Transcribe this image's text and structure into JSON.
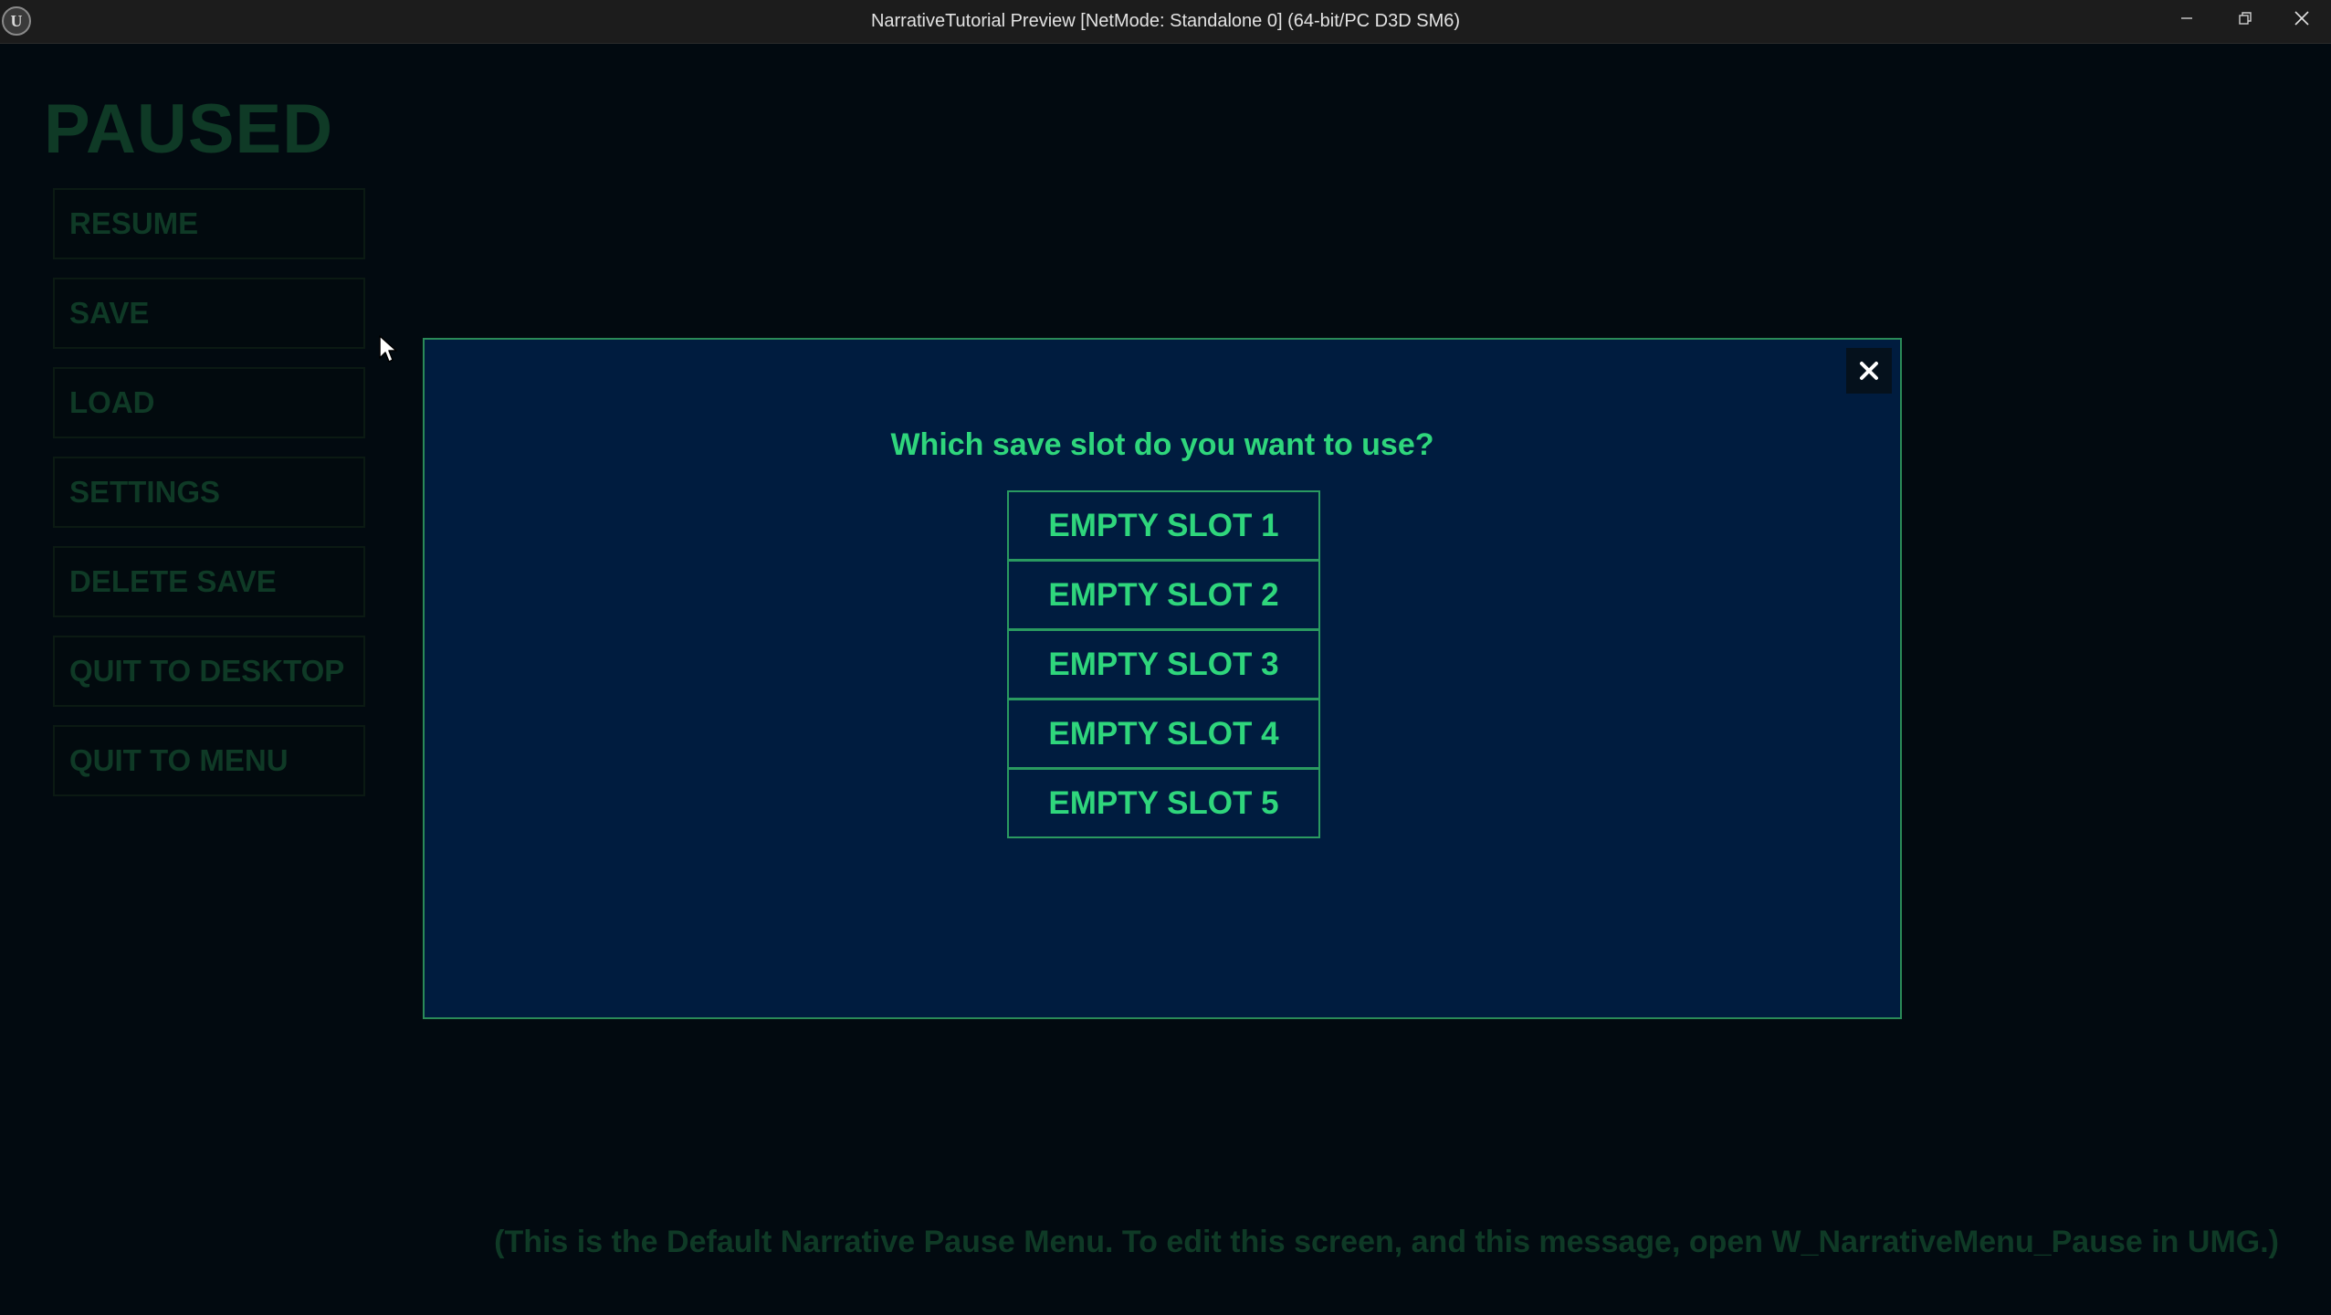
{
  "window": {
    "logo_label": "U",
    "title": "NarrativeTutorial Preview [NetMode: Standalone 0]  (64-bit/PC D3D SM6)",
    "controls": {
      "minimize_icon": "minimize-icon",
      "restore_icon": "restore-icon",
      "close_icon": "close-icon"
    }
  },
  "pause_menu": {
    "title": "PAUSED",
    "items": [
      {
        "label": "RESUME"
      },
      {
        "label": "SAVE"
      },
      {
        "label": "LOAD"
      },
      {
        "label": "SETTINGS"
      },
      {
        "label": "DELETE SAVE"
      },
      {
        "label": "QUIT TO DESKTOP"
      },
      {
        "label": "QUIT TO MENU"
      }
    ]
  },
  "save_dialog": {
    "question": "Which save slot do you want to use?",
    "close_icon": "close-icon",
    "slots": [
      {
        "label": "EMPTY SLOT 1"
      },
      {
        "label": "EMPTY SLOT 2"
      },
      {
        "label": "EMPTY SLOT 3"
      },
      {
        "label": "EMPTY SLOT 4"
      },
      {
        "label": "EMPTY SLOT 5"
      }
    ]
  },
  "footer": {
    "note": "(This is the Default Narrative Pause Menu. To edit this screen, and this message, open W_NarrativeMenu_Pause in UMG.)"
  },
  "colors": {
    "accent_green": "#2fd67c",
    "dim_green": "#0f3a26",
    "modal_background": "#001c3f",
    "page_background": "#020a10"
  }
}
